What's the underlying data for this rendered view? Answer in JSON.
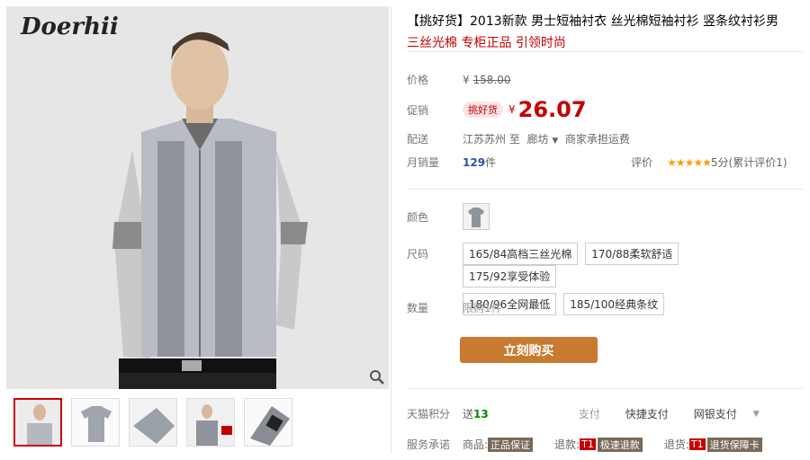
{
  "product": {
    "brand_logo": "Doerhii",
    "title": "【挑好货】2013新款 男士短袖衬衣 丝光棉短袖衬衫 竖条纹衬衫男",
    "subtitle": "三丝光棉 专柜正品 引领时尚"
  },
  "price": {
    "label": "价格",
    "currency": "¥",
    "original": "158.00",
    "promo_label": "促销",
    "promo_badge": "挑好货",
    "promo_price": "26.07"
  },
  "shipping": {
    "label": "配送",
    "from": "江苏苏州",
    "to_word": "至",
    "to": "廊坊",
    "fee_note": "商家承担运费"
  },
  "sales": {
    "label": "月销量",
    "count": "129",
    "unit": "件",
    "rating_label": "评价",
    "stars": "★★★★★",
    "rating_text": "5分(累计评价1)"
  },
  "color": {
    "label": "颜色"
  },
  "size": {
    "label": "尺码",
    "options": [
      "165/84高档三丝光棉",
      "170/88柔软舒适",
      "175/92享受体验",
      "180/96全网最低",
      "185/100经典条纹"
    ]
  },
  "quantity": {
    "label": "数量",
    "limit_text": "限购1件"
  },
  "buy_button": "立刻购买",
  "points": {
    "label": "天猫积分",
    "prefix": "送",
    "value": "13",
    "pay_label": "支付",
    "pay_quick": "快捷支付",
    "pay_bank": "网银支付"
  },
  "service": {
    "label": "服务承诺",
    "item1_label": "商品:",
    "item1_tag": "正品保证",
    "item2_label": "退款:",
    "item2_badge": "T1",
    "item2_tag": "极速退款",
    "item3_label": "退货:",
    "item3_badge": "T1",
    "item3_tag": "退货保障卡"
  },
  "colors": {
    "accent_red": "#c40000",
    "buy_button": "#c87a30",
    "star": "#ff9c00"
  }
}
